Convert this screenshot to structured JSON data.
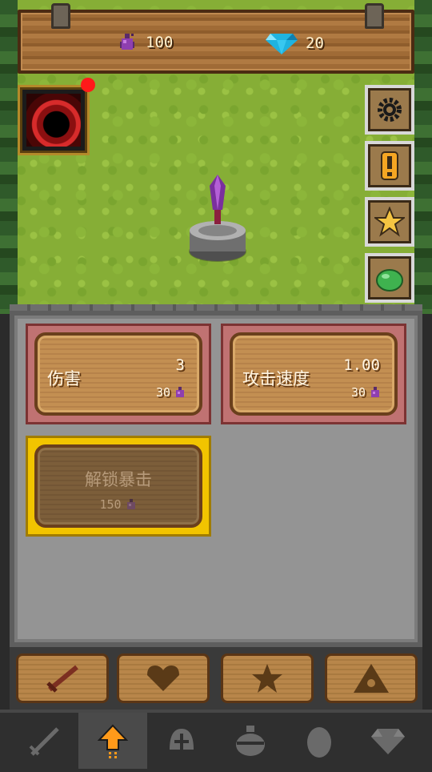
{
  "header": {
    "elixir_count": "100",
    "gem_count": "20"
  },
  "upgrades": [
    {
      "label": "伤害",
      "value": "3",
      "cost": "30"
    },
    {
      "label": "攻击速度",
      "value": "1.00",
      "cost": "30"
    }
  ],
  "locked_upgrade": {
    "label": "解锁暴击",
    "cost": "150"
  },
  "side_buttons": [
    "settings-icon",
    "alert-icon",
    "star-icon",
    "slime-icon"
  ],
  "category_tabs": [
    "sword-icon",
    "heart-icon",
    "star-icon",
    "triangle-icon"
  ],
  "bottom_nav": {
    "items": [
      "sword-icon",
      "upgrade-arrow-icon",
      "helmet-icon",
      "pot-icon",
      "egg-icon",
      "diamond-icon"
    ],
    "active_index": 1
  },
  "colors": {
    "accent_gold": "#f2c400",
    "active_arrow": "#ff9a1a",
    "alert_red": "#ff1a1a"
  }
}
